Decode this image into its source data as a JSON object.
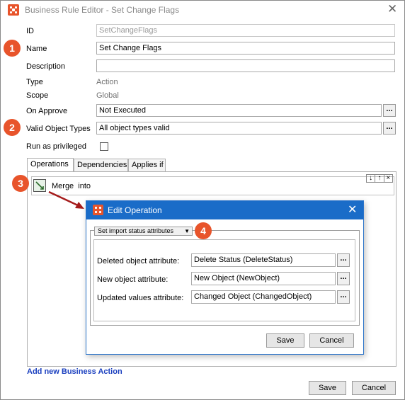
{
  "window": {
    "title": "Business Rule Editor - Set Change Flags"
  },
  "form": {
    "id_label": "ID",
    "id_value": "SetChangeFlags",
    "name_label": "Name",
    "name_value": "Set Change Flags",
    "description_label": "Description",
    "description_value": "",
    "type_label": "Type",
    "type_value": "Action",
    "scope_label": "Scope",
    "scope_value": "Global",
    "on_approve_label": "On Approve",
    "on_approve_value": "Not Executed",
    "valid_types_label": "Valid Object Types",
    "valid_types_value": "All object types valid",
    "privileged_label": "Run as privileged",
    "ellipsis": "..."
  },
  "badges": [
    "1",
    "2",
    "3",
    "4"
  ],
  "tabs": [
    "Operations",
    "Dependencies",
    "Applies if"
  ],
  "operation": {
    "text": "Merge  into"
  },
  "order_arrows": [
    "↓",
    "↑",
    "×"
  ],
  "add_action": "Add new Business Action",
  "footer": {
    "save": "Save",
    "cancel": "Cancel"
  },
  "dialog": {
    "title": "Edit Operation",
    "dropdown": "Set import status attributes",
    "deleted_label": "Deleted object attribute:",
    "deleted_value": "Delete Status (DeleteStatus)",
    "new_label": "New object attribute:",
    "new_value": "New Object (NewObject)",
    "updated_label": "Updated values attribute:",
    "updated_value": "Changed Object (ChangedObject)",
    "save": "Save",
    "cancel": "Cancel"
  },
  "colors": {
    "accent_orange": "#e8542b",
    "dialog_blue": "#1a6cc8",
    "link_blue": "#1a3fbf",
    "arrow_red": "#a51c1c"
  }
}
